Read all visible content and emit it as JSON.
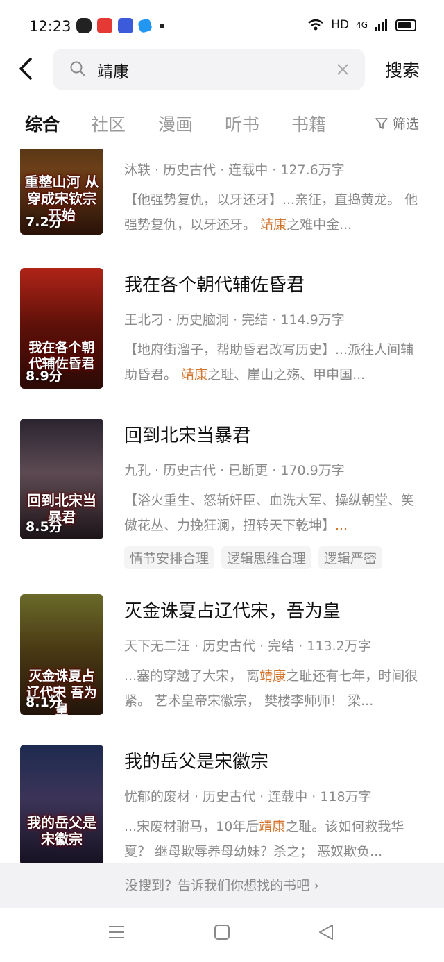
{
  "status": {
    "time": "12:23",
    "network": "HD",
    "signal": "4G"
  },
  "search": {
    "query": "靖康",
    "button": "搜索"
  },
  "tabs": [
    "综合",
    "社区",
    "漫画",
    "听书",
    "书籍"
  ],
  "filter_label": "筛选",
  "books": [
    {
      "title": "",
      "cover_text": "重整山河 从穿成宋钦宗开始",
      "score": "7.2分",
      "meta": "沐轶 · 历史古代 · 连载中 · 127.6万字",
      "desc_before": "【他强势复仇，以牙还牙】...亲征，直捣黄龙。 他强势复仇，以牙还牙。 ",
      "desc_hl": "靖康",
      "desc_after": "之难中金..."
    },
    {
      "title": "我在各个朝代辅佐昏君",
      "cover_text": "我在各个朝代辅佐昏君",
      "score": "8.9分",
      "meta": "王北刁 · 历史脑洞 · 完结 · 114.9万字",
      "desc_before": "【地府街溜子，帮助昏君改写历史】...派往人间辅助昏君。 ",
      "desc_hl": "靖康",
      "desc_after": "之耻、崖山之殇、甲申国..."
    },
    {
      "title": "回到北宋当暴君",
      "cover_text": "回到北宋当暴君",
      "score": "8.5分",
      "meta": "九孔 · 历史古代 · 已断更 · 170.9万字",
      "desc_before": "【浴火重生、怒斩奸臣、血洗大军、操纵朝堂、笑傲花丛、力挽狂澜，扭转天下乾坤】",
      "desc_hl": "...",
      "desc_after": "",
      "tags": [
        "情节安排合理",
        "逻辑思维合理",
        "逻辑严密"
      ]
    },
    {
      "title": "灭金诛夏占辽代宋，吾为皇",
      "cover_text": "灭金诛夏占辽代宋 吾为皇",
      "score": "8.1分",
      "meta": "天下无二汪 · 历史古代 · 完结 · 113.2万字",
      "desc_before": "...塞的穿越了大宋， 离",
      "desc_hl": "靖康",
      "desc_after": "之耻还有七年，时间很紧。 艺术皇帝宋徽宗， 樊楼李师师！ 梁..."
    },
    {
      "title": "我的岳父是宋徽宗",
      "cover_text": "我的岳父是宋徽宗",
      "score": "",
      "meta": "忧郁的废材 · 历史古代 · 连载中 · 118万字",
      "desc_before": "...宋废材驸马，10年后",
      "desc_hl": "靖康",
      "desc_after": "之耻。该如何救我华夏？ 继母欺辱养母幼妹？杀之； 恶奴欺负..."
    }
  ],
  "not_found": "没搜到？告诉我们你想找的书吧 ›"
}
